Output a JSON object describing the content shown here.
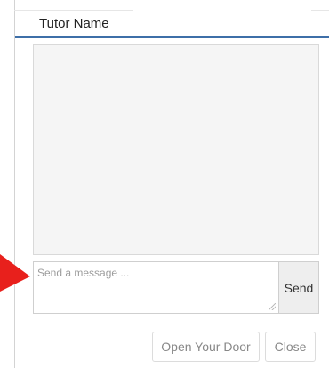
{
  "dialog": {
    "title": "Tutor Name",
    "accent_color": "#3e6fa8"
  },
  "chat": {
    "message_placeholder": "Send a message ...",
    "message_value": "",
    "send_label": "Send"
  },
  "footer": {
    "open_door_label": "Open Your Door",
    "close_label": "Close"
  },
  "annotation": {
    "arrow_icon": "red-arrow-icon",
    "arrow_color": "#e8201c"
  }
}
